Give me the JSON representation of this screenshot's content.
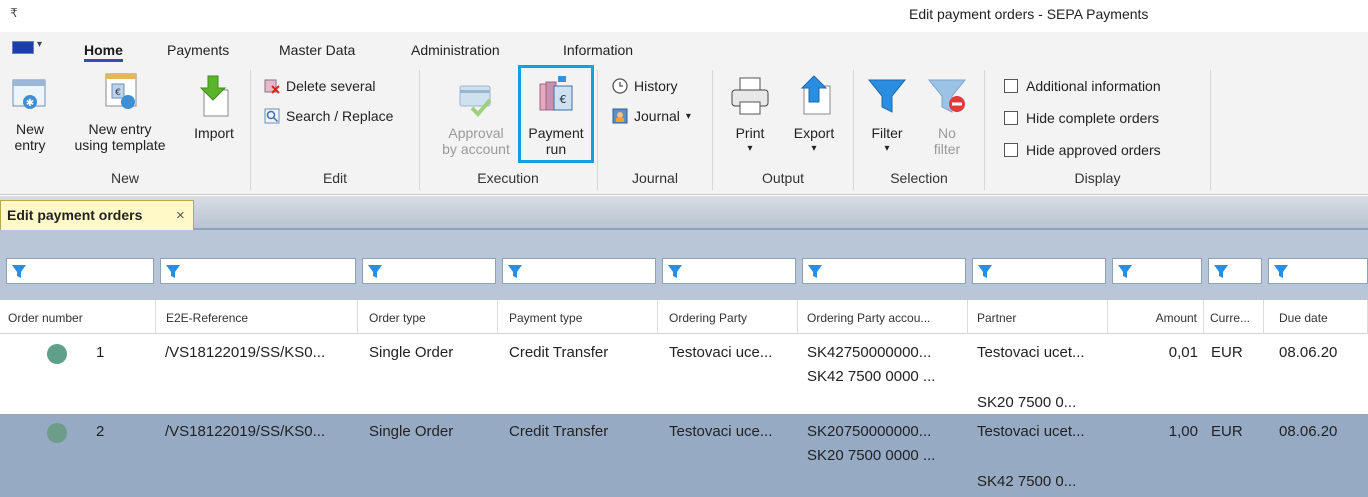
{
  "app": {
    "title": "Edit payment orders - SEPA Payments",
    "qat_symbol": "₹"
  },
  "menu": {
    "tabs": [
      "Home",
      "Payments",
      "Master Data",
      "Administration",
      "Information"
    ],
    "active": "Home"
  },
  "ribbon": {
    "new_group": {
      "label": "New",
      "new_entry": "New\nentry",
      "new_entry_template": "New entry\nusing template",
      "import": "Import"
    },
    "edit_group": {
      "label": "Edit",
      "delete_several": "Delete several",
      "search_replace": "Search / Replace"
    },
    "execution_group": {
      "label": "Execution",
      "approval_by_account": "Approval\nby account",
      "payment_run": "Payment\nrun"
    },
    "journal_group": {
      "label": "Journal",
      "history": "History",
      "journal": "Journal"
    },
    "output_group": {
      "label": "Output",
      "print": "Print",
      "export": "Export"
    },
    "selection_group": {
      "label": "Selection",
      "filter": "Filter",
      "no_filter": "No\nfilter"
    },
    "display_group": {
      "label": "Display",
      "additional_information": "Additional information",
      "hide_complete_orders": "Hide complete orders",
      "hide_approved_orders": "Hide approved orders"
    }
  },
  "document_tab": {
    "label": "Edit payment orders",
    "close": "×"
  },
  "table": {
    "columns": [
      "Order number",
      "E2E-Reference",
      "Order type",
      "Payment type",
      "Ordering Party",
      "Ordering Party accou...",
      "Partner",
      "Amount",
      "Curre...",
      "Due date"
    ],
    "rows": [
      {
        "order_number": "1",
        "e2e_reference": "/VS18122019/SS/KS0...",
        "order_type": "Single Order",
        "payment_type": "Credit Transfer",
        "ordering_party": "Testovaci uce...",
        "ordering_party_account_line1": "SK42750000000...",
        "ordering_party_account_line2": "SK42 7500 0000 ...",
        "partner_line1": "Testovaci ucet...",
        "partner_line2": "SK20 7500 0...",
        "amount": "0,01",
        "currency": "EUR",
        "due_date": "08.06.20",
        "status_color": "#5fa08a"
      },
      {
        "order_number": "2",
        "e2e_reference": "/VS18122019/SS/KS0...",
        "order_type": "Single Order",
        "payment_type": "Credit Transfer",
        "ordering_party": "Testovaci uce...",
        "ordering_party_account_line1": "SK20750000000...",
        "ordering_party_account_line2": "SK20 7500 0000 ...",
        "partner_line1": "Testovaci ucet...",
        "partner_line2": "SK42 7500 0...",
        "amount": "1,00",
        "currency": "EUR",
        "due_date": "08.06.20",
        "status_color": "#6d9c8a"
      }
    ]
  },
  "colors": {
    "highlight": "#12a0e2",
    "selected_row": "#97aac4",
    "grid_background": "#b8c6d8",
    "document_tab": "#fff9c8"
  }
}
